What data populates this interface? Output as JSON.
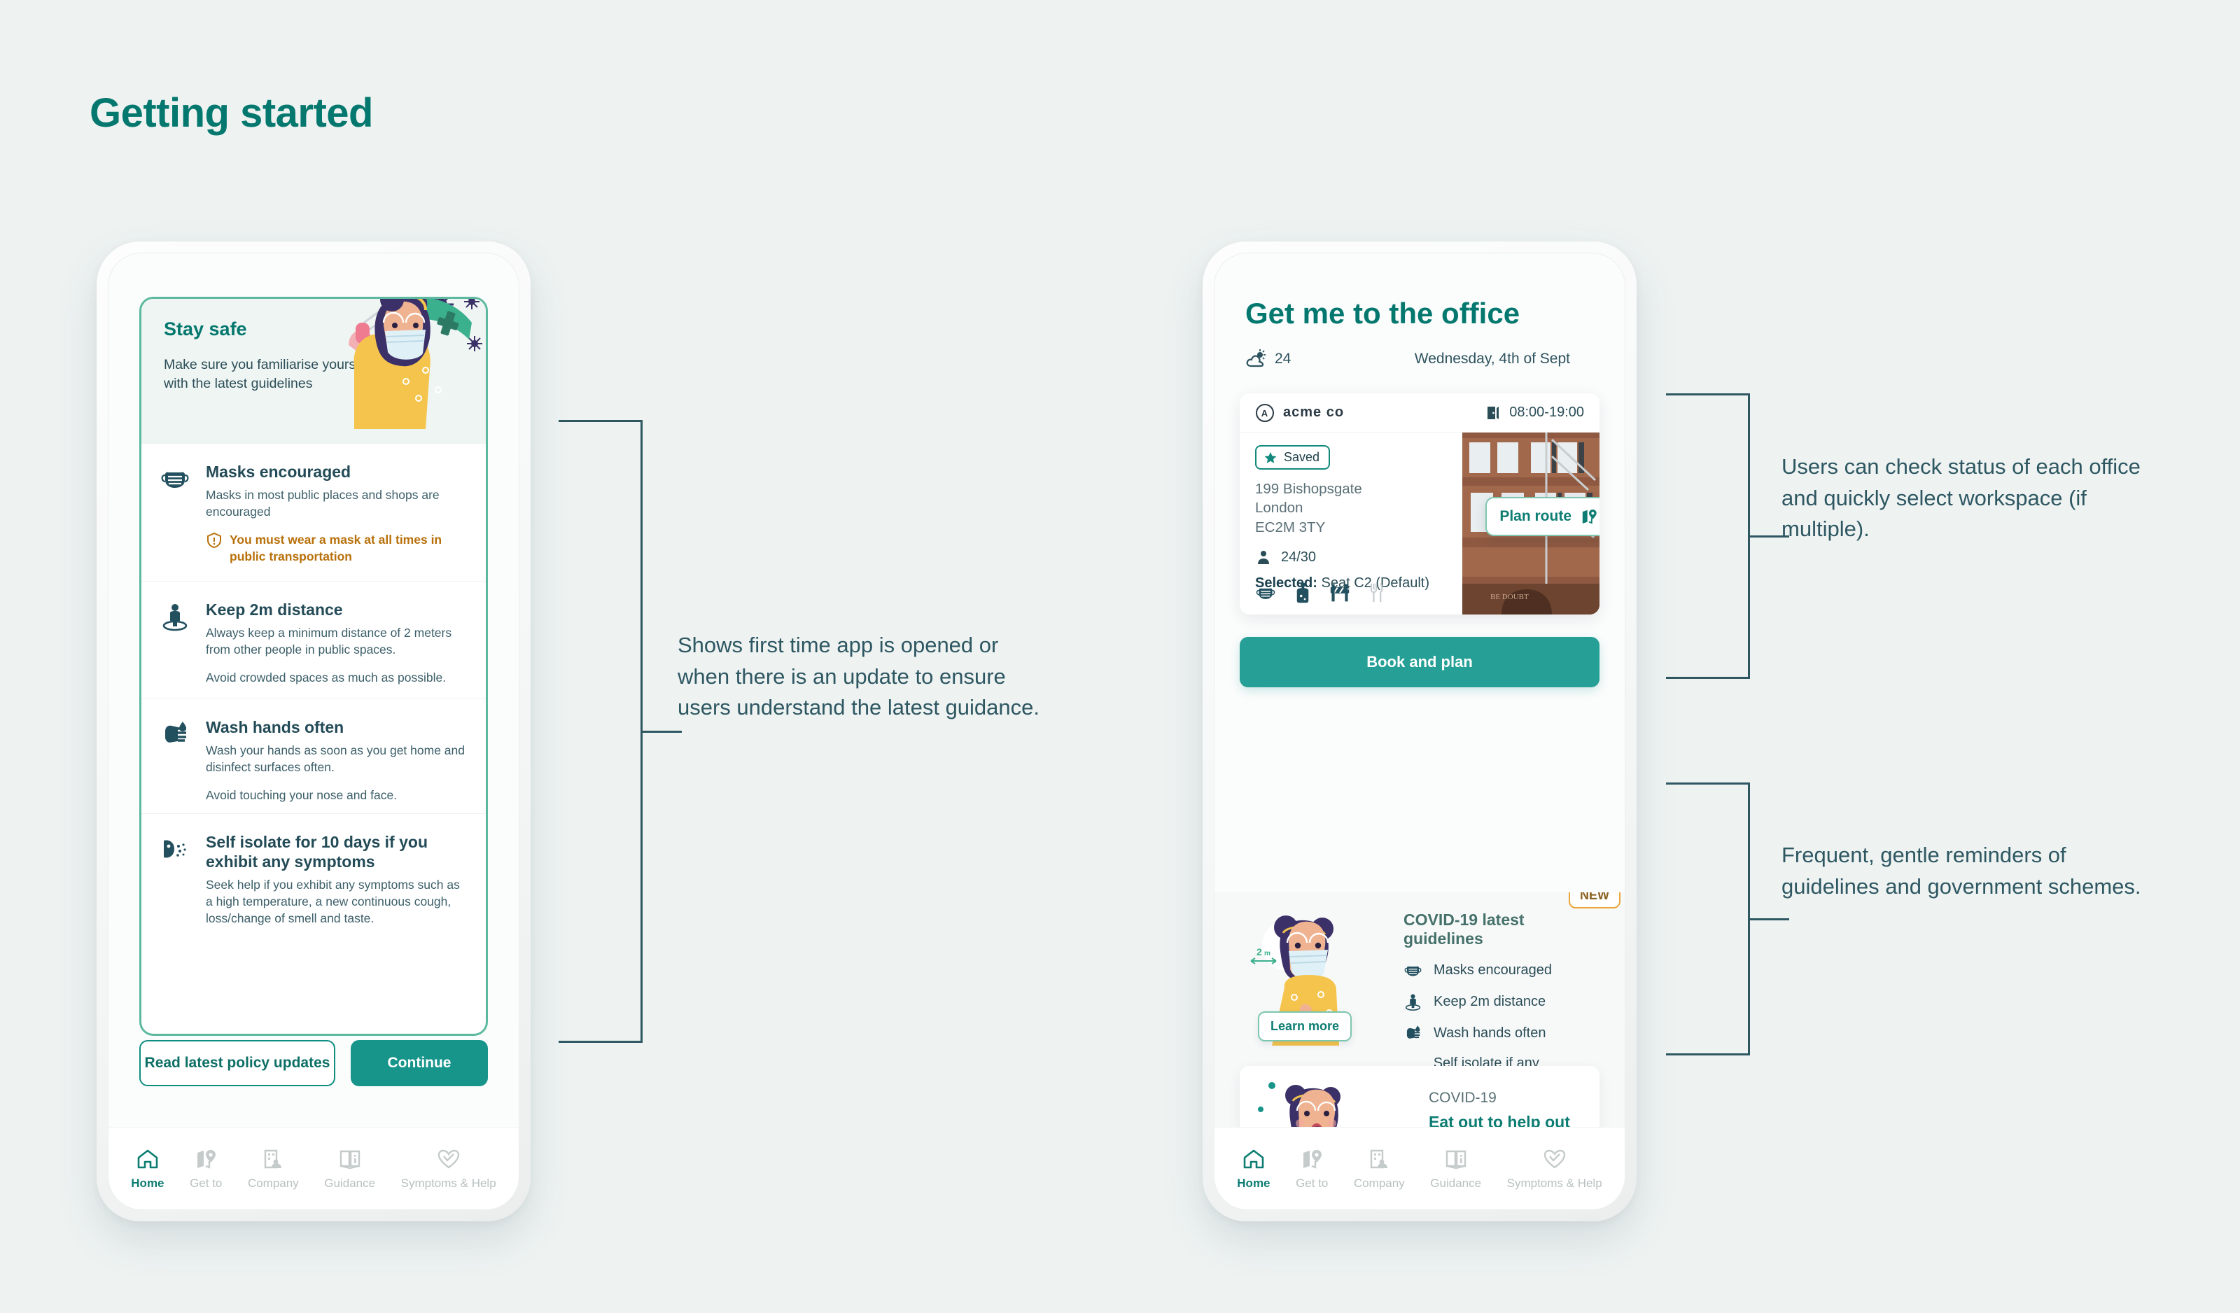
{
  "page": {
    "title": "Getting started",
    "accent": "#04786e",
    "background": "#eef3f2",
    "text_color": "#2e5762"
  },
  "phone1": {
    "card": {
      "heading": "Stay safe",
      "subheading": "Make sure you familiarise\nyourself with the latest guidelines",
      "guidelines": [
        {
          "icon": "mask-icon",
          "title": "Masks encouraged",
          "body": "Masks in most public places and shops are encouraged",
          "warning": "You must wear a mask at all times in public transportation"
        },
        {
          "icon": "distance-icon",
          "title": "Keep 2m distance",
          "body": "Always keep a minimum distance of 2 meters from other people in public spaces.",
          "body2": "Avoid crowded spaces as much as possible."
        },
        {
          "icon": "wash-hands-icon",
          "title": "Wash hands often",
          "body": "Wash your hands as soon as you get home and disinfect surfaces often.",
          "body2": "Avoid touching your nose and face."
        },
        {
          "icon": "self-isolate-icon",
          "title": "Self isolate for 10 days if you exhibit any symptoms",
          "body": "Seek help if you exhibit any symptoms such as a high temperature, a new continuous cough, loss/change of smell and taste."
        }
      ]
    },
    "actions": {
      "secondary": "Read latest policy updates",
      "primary": "Continue"
    },
    "tabs": [
      {
        "label": "Home",
        "icon": "home-icon",
        "active": true
      },
      {
        "label": "Get to",
        "icon": "map-pin-icon",
        "active": false
      },
      {
        "label": "Company",
        "icon": "company-icon",
        "active": false
      },
      {
        "label": "Guidance",
        "icon": "book-info-icon",
        "active": false
      },
      {
        "label": "Symptoms & Help",
        "icon": "heart-icon",
        "active": false
      }
    ]
  },
  "phone2": {
    "title": "Get me to the office",
    "weather": {
      "icon": "sun-cloud-icon",
      "value": "24"
    },
    "date": "Wednesday, 4th of Sept",
    "office_card": {
      "company": "acme co",
      "company_logo": "circle-a-icon",
      "hours_icon": "door-icon",
      "hours": "08:00-19:00",
      "saved_label": "Saved",
      "saved_icon": "star-icon",
      "address_line1": "199 Bishopsgate",
      "address_line2": "London",
      "address_line3": "EC2M 3TY",
      "occupancy_icon": "person-icon",
      "occupancy": "24/30",
      "seat_label": "Selected:",
      "seat_value": "Seat C2 (Default)",
      "amenities": [
        {
          "icon": "mask-icon",
          "available": true
        },
        {
          "icon": "sanitizer-icon",
          "available": true
        },
        {
          "icon": "barrier-icon",
          "available": true
        },
        {
          "icon": "cutlery-icon",
          "available": false
        }
      ],
      "plan_route": "Plan route",
      "plan_route_icon": "map-pin-icon"
    },
    "book_button": "Book and plan",
    "guidelines_block": {
      "title": "COVID-19 latest guidelines",
      "learn_more": "Learn more",
      "distance_label": "2m",
      "items": [
        {
          "icon": "mask-icon",
          "label": "Masks encouraged"
        },
        {
          "icon": "distance-icon",
          "label": "Keep 2m distance"
        },
        {
          "icon": "wash-hands-icon",
          "label": "Wash hands often"
        },
        {
          "icon": "self-isolate-icon",
          "label": "Self isolate if any symptoms"
        }
      ]
    },
    "promo": {
      "badge": "NEW",
      "kicker": "COVID-19",
      "title": "Eat out to help out"
    },
    "tabs": [
      {
        "label": "Home",
        "icon": "home-icon",
        "active": true
      },
      {
        "label": "Get to",
        "icon": "map-pin-icon",
        "active": false
      },
      {
        "label": "Company",
        "icon": "company-icon",
        "active": false
      },
      {
        "label": "Guidance",
        "icon": "book-info-icon",
        "active": false
      },
      {
        "label": "Symptoms & Help",
        "icon": "heart-icon",
        "active": false
      }
    ]
  },
  "annotations": [
    {
      "text": "Shows first time app is opened or when there is an update to ensure users understand the latest guidance."
    },
    {
      "text": "Users can check status of each office and quickly select workspace (if multiple)."
    },
    {
      "text": "Frequent, gentle reminders of guidelines and government schemes."
    }
  ]
}
